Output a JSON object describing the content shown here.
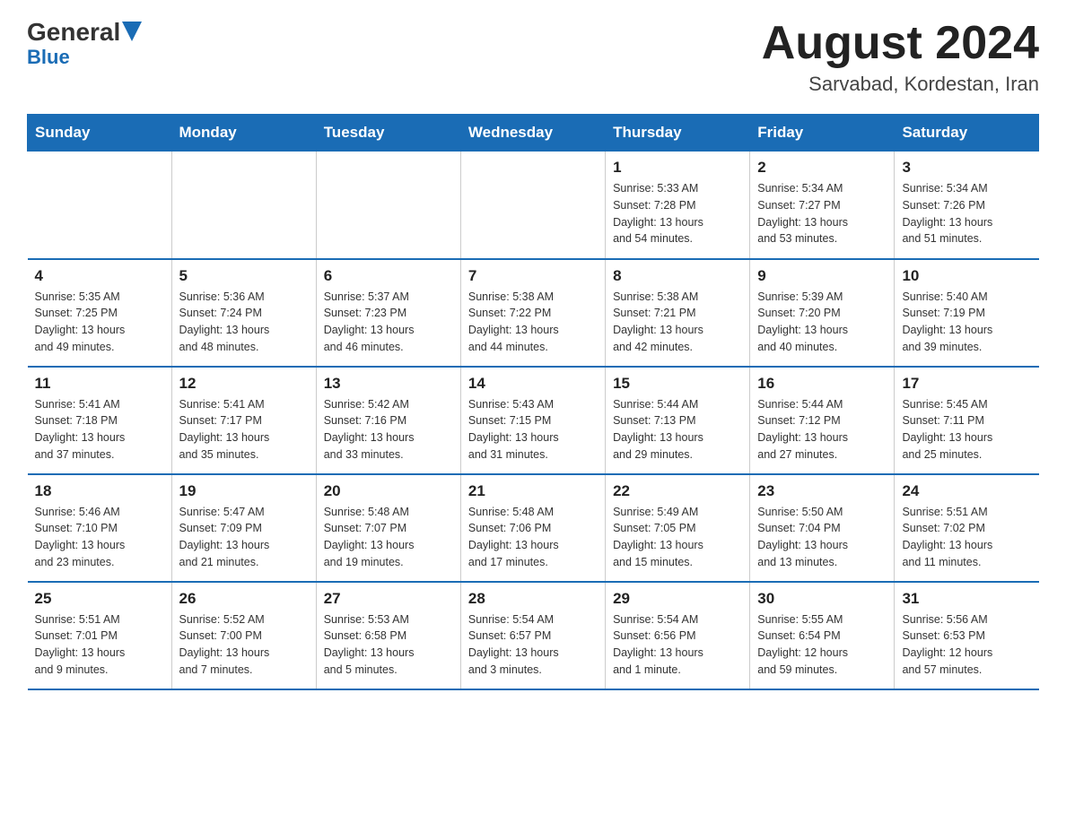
{
  "header": {
    "logo_general": "General",
    "logo_blue": "Blue",
    "month_title": "August 2024",
    "location": "Sarvabad, Kordestan, Iran"
  },
  "days_of_week": [
    "Sunday",
    "Monday",
    "Tuesday",
    "Wednesday",
    "Thursday",
    "Friday",
    "Saturday"
  ],
  "weeks": [
    [
      {
        "day": "",
        "info": ""
      },
      {
        "day": "",
        "info": ""
      },
      {
        "day": "",
        "info": ""
      },
      {
        "day": "",
        "info": ""
      },
      {
        "day": "1",
        "info": "Sunrise: 5:33 AM\nSunset: 7:28 PM\nDaylight: 13 hours\nand 54 minutes."
      },
      {
        "day": "2",
        "info": "Sunrise: 5:34 AM\nSunset: 7:27 PM\nDaylight: 13 hours\nand 53 minutes."
      },
      {
        "day": "3",
        "info": "Sunrise: 5:34 AM\nSunset: 7:26 PM\nDaylight: 13 hours\nand 51 minutes."
      }
    ],
    [
      {
        "day": "4",
        "info": "Sunrise: 5:35 AM\nSunset: 7:25 PM\nDaylight: 13 hours\nand 49 minutes."
      },
      {
        "day": "5",
        "info": "Sunrise: 5:36 AM\nSunset: 7:24 PM\nDaylight: 13 hours\nand 48 minutes."
      },
      {
        "day": "6",
        "info": "Sunrise: 5:37 AM\nSunset: 7:23 PM\nDaylight: 13 hours\nand 46 minutes."
      },
      {
        "day": "7",
        "info": "Sunrise: 5:38 AM\nSunset: 7:22 PM\nDaylight: 13 hours\nand 44 minutes."
      },
      {
        "day": "8",
        "info": "Sunrise: 5:38 AM\nSunset: 7:21 PM\nDaylight: 13 hours\nand 42 minutes."
      },
      {
        "day": "9",
        "info": "Sunrise: 5:39 AM\nSunset: 7:20 PM\nDaylight: 13 hours\nand 40 minutes."
      },
      {
        "day": "10",
        "info": "Sunrise: 5:40 AM\nSunset: 7:19 PM\nDaylight: 13 hours\nand 39 minutes."
      }
    ],
    [
      {
        "day": "11",
        "info": "Sunrise: 5:41 AM\nSunset: 7:18 PM\nDaylight: 13 hours\nand 37 minutes."
      },
      {
        "day": "12",
        "info": "Sunrise: 5:41 AM\nSunset: 7:17 PM\nDaylight: 13 hours\nand 35 minutes."
      },
      {
        "day": "13",
        "info": "Sunrise: 5:42 AM\nSunset: 7:16 PM\nDaylight: 13 hours\nand 33 minutes."
      },
      {
        "day": "14",
        "info": "Sunrise: 5:43 AM\nSunset: 7:15 PM\nDaylight: 13 hours\nand 31 minutes."
      },
      {
        "day": "15",
        "info": "Sunrise: 5:44 AM\nSunset: 7:13 PM\nDaylight: 13 hours\nand 29 minutes."
      },
      {
        "day": "16",
        "info": "Sunrise: 5:44 AM\nSunset: 7:12 PM\nDaylight: 13 hours\nand 27 minutes."
      },
      {
        "day": "17",
        "info": "Sunrise: 5:45 AM\nSunset: 7:11 PM\nDaylight: 13 hours\nand 25 minutes."
      }
    ],
    [
      {
        "day": "18",
        "info": "Sunrise: 5:46 AM\nSunset: 7:10 PM\nDaylight: 13 hours\nand 23 minutes."
      },
      {
        "day": "19",
        "info": "Sunrise: 5:47 AM\nSunset: 7:09 PM\nDaylight: 13 hours\nand 21 minutes."
      },
      {
        "day": "20",
        "info": "Sunrise: 5:48 AM\nSunset: 7:07 PM\nDaylight: 13 hours\nand 19 minutes."
      },
      {
        "day": "21",
        "info": "Sunrise: 5:48 AM\nSunset: 7:06 PM\nDaylight: 13 hours\nand 17 minutes."
      },
      {
        "day": "22",
        "info": "Sunrise: 5:49 AM\nSunset: 7:05 PM\nDaylight: 13 hours\nand 15 minutes."
      },
      {
        "day": "23",
        "info": "Sunrise: 5:50 AM\nSunset: 7:04 PM\nDaylight: 13 hours\nand 13 minutes."
      },
      {
        "day": "24",
        "info": "Sunrise: 5:51 AM\nSunset: 7:02 PM\nDaylight: 13 hours\nand 11 minutes."
      }
    ],
    [
      {
        "day": "25",
        "info": "Sunrise: 5:51 AM\nSunset: 7:01 PM\nDaylight: 13 hours\nand 9 minutes."
      },
      {
        "day": "26",
        "info": "Sunrise: 5:52 AM\nSunset: 7:00 PM\nDaylight: 13 hours\nand 7 minutes."
      },
      {
        "day": "27",
        "info": "Sunrise: 5:53 AM\nSunset: 6:58 PM\nDaylight: 13 hours\nand 5 minutes."
      },
      {
        "day": "28",
        "info": "Sunrise: 5:54 AM\nSunset: 6:57 PM\nDaylight: 13 hours\nand 3 minutes."
      },
      {
        "day": "29",
        "info": "Sunrise: 5:54 AM\nSunset: 6:56 PM\nDaylight: 13 hours\nand 1 minute."
      },
      {
        "day": "30",
        "info": "Sunrise: 5:55 AM\nSunset: 6:54 PM\nDaylight: 12 hours\nand 59 minutes."
      },
      {
        "day": "31",
        "info": "Sunrise: 5:56 AM\nSunset: 6:53 PM\nDaylight: 12 hours\nand 57 minutes."
      }
    ]
  ]
}
